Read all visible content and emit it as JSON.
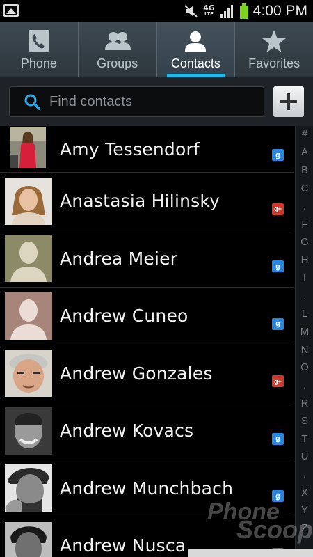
{
  "status_bar": {
    "time": "4:00 PM",
    "network": "4G",
    "network_sub": "LTE",
    "icons": [
      "gallery-icon",
      "mute-icon",
      "signal-icon",
      "battery-icon"
    ],
    "battery_color": "#7ed321"
  },
  "tabs": [
    {
      "label": "Phone",
      "icon": "phone-icon",
      "active": false
    },
    {
      "label": "Groups",
      "icon": "groups-icon",
      "active": false
    },
    {
      "label": "Contacts",
      "icon": "contact-icon",
      "active": true
    },
    {
      "label": "Favorites",
      "icon": "star-icon",
      "active": false
    }
  ],
  "search": {
    "placeholder": "Find contacts",
    "value": ""
  },
  "add_button": {
    "icon": "plus-icon"
  },
  "contacts": [
    {
      "name": "Amy Tessendorf",
      "account": "google"
    },
    {
      "name": "Anastasia Hilinsky",
      "account": "google-plus"
    },
    {
      "name": "Andrea Meier",
      "account": "google"
    },
    {
      "name": "Andrew Cuneo",
      "account": "google"
    },
    {
      "name": "Andrew Gonzales",
      "account": "google-plus"
    },
    {
      "name": "Andrew Kovacs",
      "account": "google"
    },
    {
      "name": "Andrew Munchbach",
      "account": "google"
    },
    {
      "name": "Andrew Nusca",
      "account": "google-plus"
    }
  ],
  "badges": {
    "google": "g",
    "google_plus": "g+"
  },
  "index_letters": [
    "#",
    "A",
    "B",
    "C",
    ".",
    "F",
    "G",
    "H",
    "I",
    ".",
    "L",
    "M",
    "N",
    "O",
    ".",
    "R",
    "S",
    "T",
    "U",
    ".",
    "X",
    "Y",
    "Z"
  ],
  "watermark": {
    "line1": "Phone",
    "line2": "Scoop"
  },
  "colors": {
    "accent": "#27b6e8",
    "google_badge": "#2a86de",
    "gplus_badge": "#d2382a"
  }
}
